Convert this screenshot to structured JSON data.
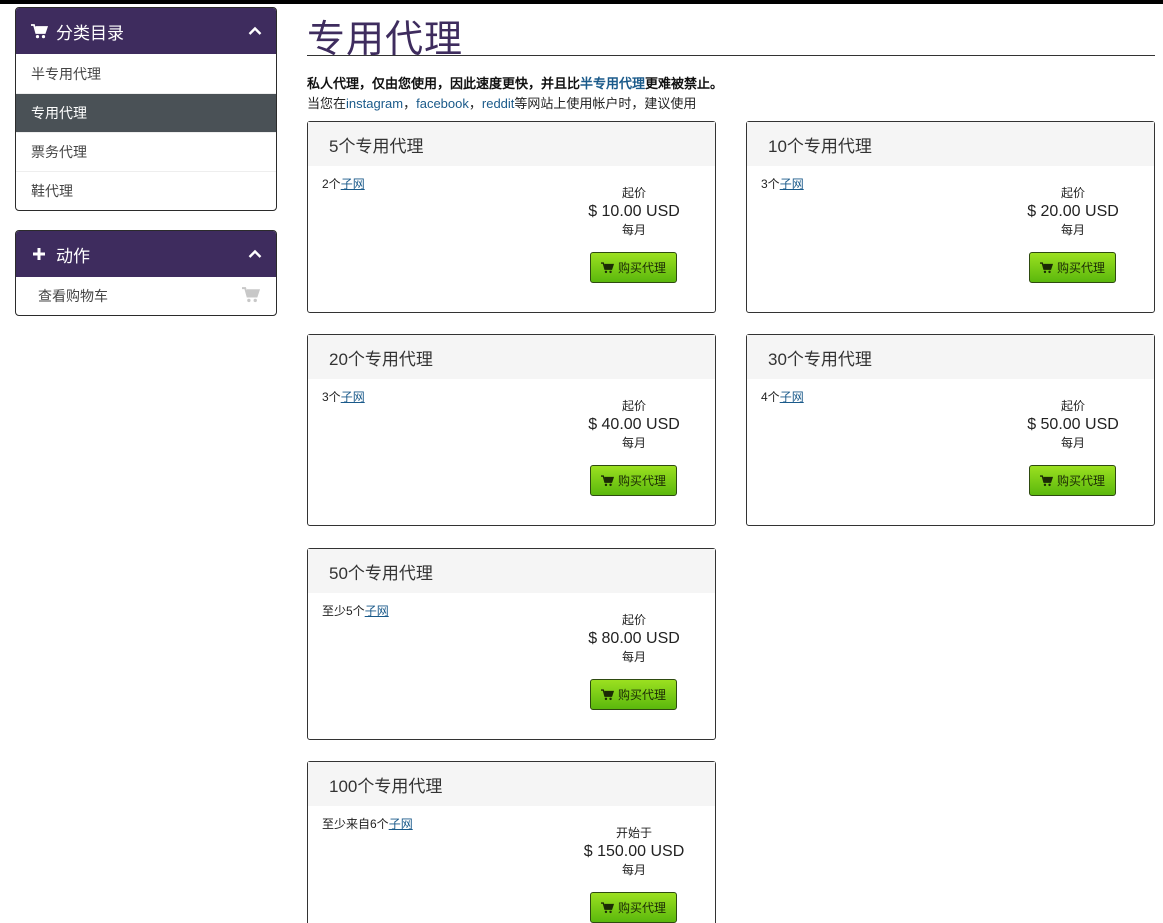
{
  "sidebar": {
    "categories": {
      "title": "分类目录",
      "items": [
        {
          "label": "半专用代理",
          "active": false
        },
        {
          "label": "专用代理",
          "active": true
        },
        {
          "label": "票务代理",
          "active": false
        },
        {
          "label": "鞋代理",
          "active": false
        }
      ]
    },
    "actions": {
      "title": "动作",
      "items": [
        {
          "label": "查看购物车",
          "icon": "cart-icon"
        }
      ]
    }
  },
  "main": {
    "title": "专用代理",
    "intro": {
      "line1_before": "私人代理，仅由您使用，因此速度更快，并且比",
      "line1_link": "半专用代理",
      "line1_after": "更难被禁止。",
      "line2_prefix": "当您在",
      "line2_link1": "instagram",
      "line2_sep1": "，",
      "line2_link2": "facebook",
      "line2_sep2": "，",
      "line2_link3": "reddit",
      "line2_suffix": "等网站上使用帐户时，建议使用"
    },
    "products": [
      {
        "name": "5个专用代理",
        "subnet_prefix": "2个",
        "subnet_link": "子网",
        "price_label": "起价",
        "price": "$ 10.00 USD",
        "period": "每月",
        "button": "购买代理"
      },
      {
        "name": "10个专用代理",
        "subnet_prefix": "3个",
        "subnet_link": "子网",
        "price_label": "起价",
        "price": "$ 20.00 USD",
        "period": "每月",
        "button": "购买代理"
      },
      {
        "name": "20个专用代理",
        "subnet_prefix": "3个",
        "subnet_link": "子网",
        "price_label": "起价",
        "price": "$ 40.00 USD",
        "period": "每月",
        "button": "购买代理"
      },
      {
        "name": "30个专用代理",
        "subnet_prefix": "4个",
        "subnet_link": "子网",
        "price_label": "起价",
        "price": "$ 50.00 USD",
        "period": "每月",
        "button": "购买代理"
      },
      {
        "name": "50个专用代理",
        "subnet_prefix": "至少5个",
        "subnet_link": "子网",
        "price_label": "起价",
        "price": "$ 80.00 USD",
        "period": "每月",
        "button": "购买代理"
      },
      {
        "name": "100个专用代理",
        "subnet_prefix": "至少来自6个",
        "subnet_link": "子网",
        "price_label": "开始于",
        "price": "$ 150.00 USD",
        "period": "每月",
        "button": "购买代理"
      }
    ]
  },
  "colors": {
    "header_purple": "#3e2c5e",
    "active_item": "#4a5156",
    "button_green": "#7ccf16",
    "link_blue": "#1a5a8a"
  }
}
